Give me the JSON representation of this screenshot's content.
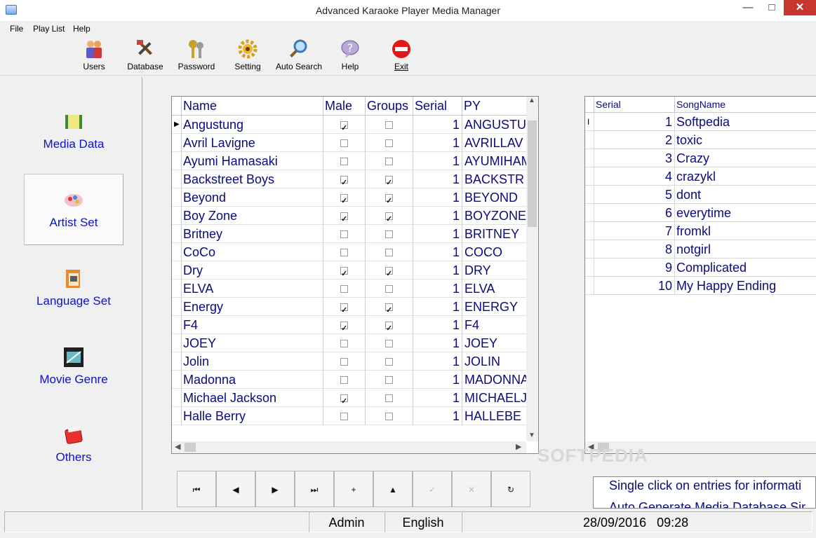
{
  "window": {
    "title": "Advanced Karaoke Player Media Manager"
  },
  "menu": [
    "File",
    "Play List",
    "Help"
  ],
  "toolbar": [
    {
      "label": "Users",
      "icon": "users-icon"
    },
    {
      "label": "Database",
      "icon": "database-tools-icon"
    },
    {
      "label": "Password",
      "icon": "password-keys-icon"
    },
    {
      "label": "Setting",
      "icon": "gear-icon"
    },
    {
      "label": "Auto Search",
      "icon": "magnifier-icon"
    },
    {
      "label": "Help",
      "icon": "help-question-icon"
    },
    {
      "label": "Exit",
      "icon": "stop-exit-icon"
    }
  ],
  "sidebar": [
    {
      "label": "Media Data",
      "icon": "media-data-icon"
    },
    {
      "label": "Artist Set",
      "icon": "artist-set-icon",
      "active": true
    },
    {
      "label": "Language Set",
      "icon": "language-set-icon"
    },
    {
      "label": "Movie Genre",
      "icon": "movie-genre-icon"
    },
    {
      "label": "Others",
      "icon": "others-icon"
    }
  ],
  "artist_grid": {
    "columns": [
      "Name",
      "Male",
      "Groups",
      "Serial",
      "PY"
    ],
    "rows": [
      {
        "name": "Angustung",
        "male": true,
        "groups": false,
        "serial": "1",
        "py": "ANGUSTU"
      },
      {
        "name": "Avril Lavigne",
        "male": false,
        "groups": false,
        "serial": "1",
        "py": "AVRILLAV"
      },
      {
        "name": "Ayumi Hamasaki",
        "male": false,
        "groups": false,
        "serial": "1",
        "py": "AYUMIHAM"
      },
      {
        "name": "Backstreet Boys",
        "male": true,
        "groups": true,
        "serial": "1",
        "py": "BACKSTR"
      },
      {
        "name": "Beyond",
        "male": true,
        "groups": true,
        "serial": "1",
        "py": "BEYOND"
      },
      {
        "name": "Boy Zone",
        "male": true,
        "groups": true,
        "serial": "1",
        "py": "BOYZONE"
      },
      {
        "name": "Britney",
        "male": false,
        "groups": false,
        "serial": "1",
        "py": "BRITNEY"
      },
      {
        "name": "CoCo",
        "male": false,
        "groups": false,
        "serial": "1",
        "py": "COCO"
      },
      {
        "name": "Dry",
        "male": true,
        "groups": true,
        "serial": "1",
        "py": "DRY"
      },
      {
        "name": "ELVA",
        "male": false,
        "groups": false,
        "serial": "1",
        "py": "ELVA"
      },
      {
        "name": "Energy",
        "male": true,
        "groups": true,
        "serial": "1",
        "py": "ENERGY"
      },
      {
        "name": "F4",
        "male": true,
        "groups": true,
        "serial": "1",
        "py": "F4"
      },
      {
        "name": "JOEY",
        "male": false,
        "groups": false,
        "serial": "1",
        "py": "JOEY"
      },
      {
        "name": "Jolin",
        "male": false,
        "groups": false,
        "serial": "1",
        "py": "JOLIN"
      },
      {
        "name": "Madonna",
        "male": false,
        "groups": false,
        "serial": "1",
        "py": "MADONNA"
      },
      {
        "name": "Michael Jackson",
        "male": true,
        "groups": false,
        "serial": "1",
        "py": "MICHAELJ"
      },
      {
        "name": "Halle Berry",
        "male": false,
        "groups": false,
        "serial": "1",
        "py": "HALLEBE"
      }
    ]
  },
  "song_grid": {
    "columns": [
      "Serial",
      "SongName"
    ],
    "rows": [
      {
        "serial": "1",
        "song": "Softpedia"
      },
      {
        "serial": "2",
        "song": "toxic"
      },
      {
        "serial": "3",
        "song": "Crazy"
      },
      {
        "serial": "4",
        "song": "crazykl"
      },
      {
        "serial": "5",
        "song": "dont"
      },
      {
        "serial": "6",
        "song": "everytime"
      },
      {
        "serial": "7",
        "song": "fromkl"
      },
      {
        "serial": "8",
        "song": "notgirl"
      },
      {
        "serial": "9",
        "song": "Complicated"
      },
      {
        "serial": "10",
        "song": "My Happy Ending"
      }
    ]
  },
  "navigator": [
    {
      "glyph": "⏮",
      "name": "first-record-button",
      "enabled": true
    },
    {
      "glyph": "◀",
      "name": "prior-record-button",
      "enabled": true
    },
    {
      "glyph": "▶",
      "name": "next-record-button",
      "enabled": true
    },
    {
      "glyph": "⏭",
      "name": "last-record-button",
      "enabled": true
    },
    {
      "glyph": "+",
      "name": "insert-record-button",
      "enabled": true
    },
    {
      "glyph": "▲",
      "name": "delete-record-button",
      "enabled": true
    },
    {
      "glyph": "✓",
      "name": "post-record-button",
      "enabled": false
    },
    {
      "glyph": "✕",
      "name": "cancel-record-button",
      "enabled": false
    },
    {
      "glyph": "↻",
      "name": "refresh-record-button",
      "enabled": true
    }
  ],
  "info": {
    "line1": "Single click on entries for informati",
    "line2": "Auto Generate Media Database Sir"
  },
  "status": {
    "user": "Admin",
    "language": "English",
    "date": "28/09/2016",
    "time": "09:28"
  },
  "watermark": "SOFTPEDIA",
  "colors": {
    "link_blue": "#1010c8",
    "grid_text": "#0a0a80",
    "close_red": "#c7372f"
  }
}
